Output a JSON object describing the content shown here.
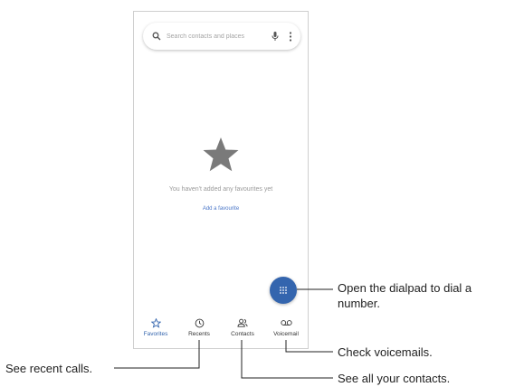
{
  "search": {
    "placeholder": "Search contacts and places"
  },
  "empty_state": {
    "message": "You haven't added any favourites yet",
    "action": "Add a favourite"
  },
  "nav": [
    {
      "label": "Favorites",
      "icon": "star-outline-icon",
      "active": true
    },
    {
      "label": "Recents",
      "icon": "clock-icon"
    },
    {
      "label": "Contacts",
      "icon": "people-icon"
    },
    {
      "label": "Voicemail",
      "icon": "voicemail-icon"
    }
  ],
  "callouts": {
    "dialpad_line1": "Open the dialpad to dial a",
    "dialpad_line2": "number.",
    "voicemail": "Check voicemails.",
    "recents": "See recent calls.",
    "contacts": "See all your contacts."
  },
  "colors": {
    "accent": "#3465ae",
    "link": "#4a76c8",
    "star": "#7a7a7a"
  }
}
